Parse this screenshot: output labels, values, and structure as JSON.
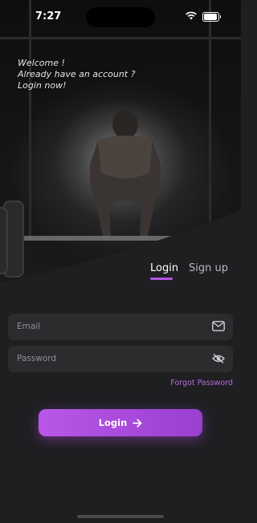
{
  "status_bar": {
    "time": "7:27"
  },
  "welcome": {
    "line1": "Welcome !",
    "line2": "Already have an account ?",
    "line3": "Login now!"
  },
  "tabs": [
    {
      "label": "Login",
      "active": true
    },
    {
      "label": "Sign up",
      "active": false
    }
  ],
  "form": {
    "email_placeholder": "Email",
    "email_icon": "mail-icon",
    "password_placeholder": "Password",
    "password_icon": "eye-off-icon",
    "forgot_label": "Forgot Password"
  },
  "login_button": {
    "label": "Login",
    "icon": "arrow-right-icon"
  },
  "colors": {
    "accent": "#b653e4",
    "background": "#1f1f22",
    "field_bg": "#2c2c2f"
  }
}
